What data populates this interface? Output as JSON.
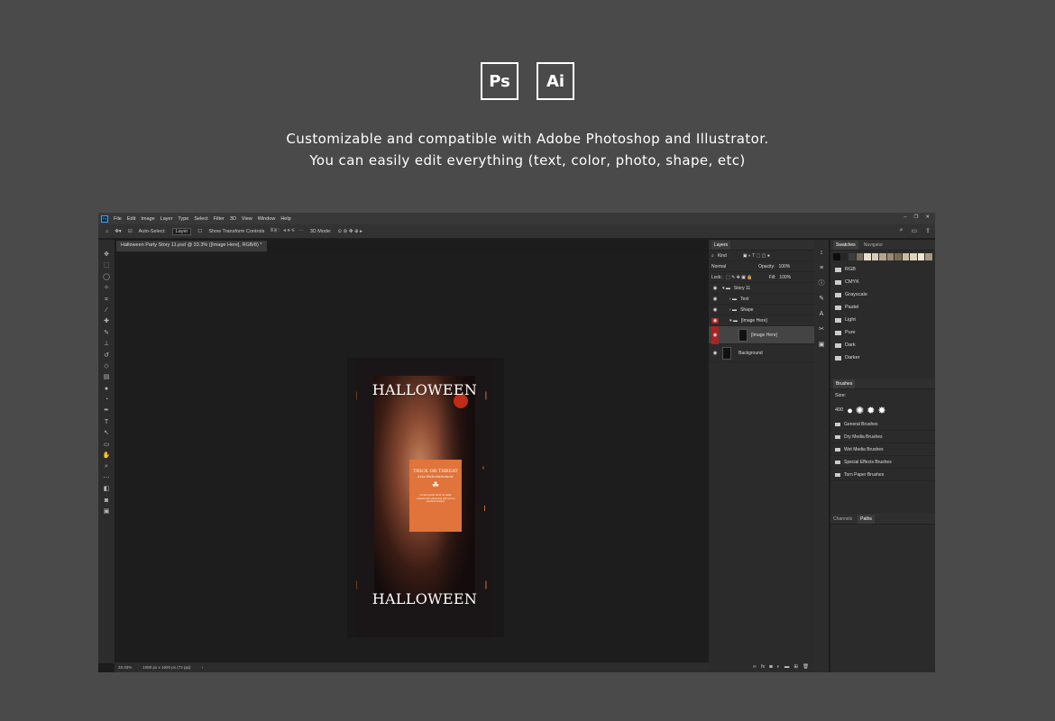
{
  "header": {
    "logos": [
      "Ps",
      "Ai"
    ],
    "tagline_line1": "Customizable and compatible with Adobe Photoshop and Illustrator.",
    "tagline_line2": "You can easily edit everything (text, color, photo, shape, etc)"
  },
  "menubar": {
    "items": [
      "File",
      "Edit",
      "Image",
      "Layer",
      "Type",
      "Select",
      "Filter",
      "3D",
      "View",
      "Window",
      "Help"
    ]
  },
  "options": {
    "auto_select": "Auto-Select:",
    "layer": "Layer",
    "show_transform": "Show Transform Controls",
    "mode_3d": "3D Mode:"
  },
  "document": {
    "tab": "Halloween Party Story 11.psd @ 33.3% ([Image Here], RGB/8) *",
    "zoom": "33.33%",
    "size": "1080 px x 1920 px (72 ppi)"
  },
  "artwork": {
    "title_top": "HALLOWEEN",
    "title_bottom": "HALLOWEEN",
    "card_title": "TRICK OR THREAT",
    "card_sub": "Live Entertainment",
    "card_body": "Lorem ipsum dolor sit amet consectetur adipiscing elit sed do eiusmod tempor"
  },
  "layers_panel": {
    "tab": "Layers",
    "kind": "Kind",
    "blend": "Normal",
    "opacity_label": "Opacity:",
    "opacity": "100%",
    "lock_label": "Lock:",
    "fill_label": "Fill:",
    "fill": "100%",
    "layers": [
      {
        "name": "Story 11"
      },
      {
        "name": "Text"
      },
      {
        "name": "Shape"
      },
      {
        "name": "[Image Here]"
      },
      {
        "name": "[Image Here]"
      },
      {
        "name": "Background"
      }
    ]
  },
  "swatches_panel": {
    "tabs": [
      "Swatches",
      "Navigator"
    ],
    "colors": [
      "#0d0d0d",
      "#262626",
      "#3d3d3d",
      "#7a6e5f",
      "#e6e0d0",
      "#d8ccb4",
      "#b6a78c",
      "#9a8a70",
      "#7c6b55",
      "#c9bea3",
      "#ddd3bb",
      "#efe8d6",
      "#a89880"
    ],
    "groups": [
      "RGB",
      "CMYK",
      "Grayscale",
      "Pastel",
      "Light",
      "Pure",
      "Dark",
      "Darker"
    ]
  },
  "brushes_panel": {
    "tab": "Brushes",
    "size_label": "Size:",
    "brush_size": "400",
    "groups": [
      "General Brushes",
      "Dry Media Brushes",
      "Wet Media Brushes",
      "Special Effects Brushes",
      "Torn Paper Brushes"
    ]
  },
  "paths_panel": {
    "tabs": [
      "Channels",
      "Paths"
    ]
  }
}
